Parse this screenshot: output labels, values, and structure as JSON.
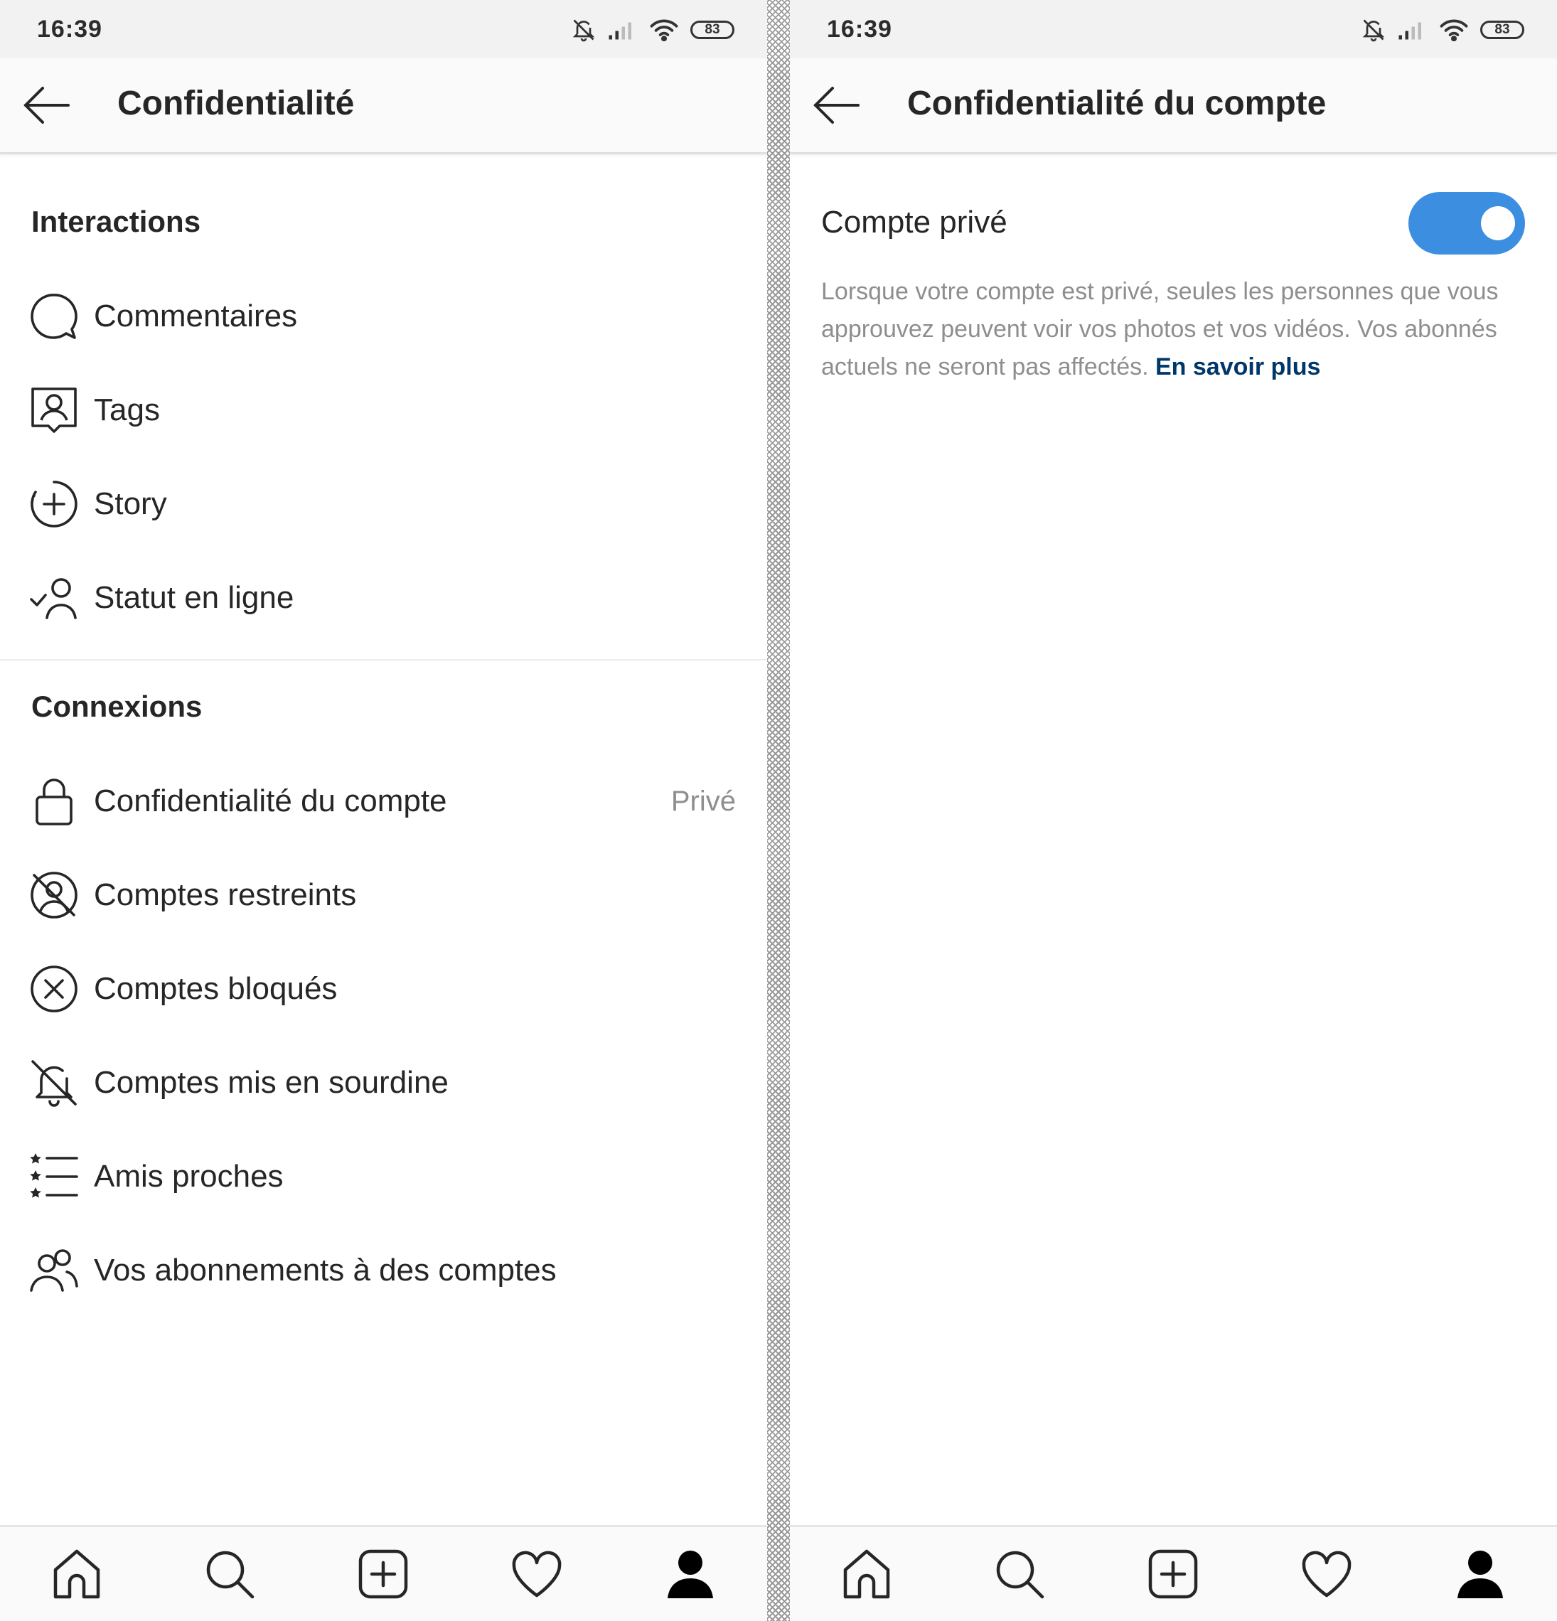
{
  "status_bar": {
    "time": "16:39",
    "battery": "83"
  },
  "left_screen": {
    "title": "Confidentialité",
    "sections": [
      {
        "header": "Interactions",
        "items": [
          {
            "icon": "comment-icon",
            "label": "Commentaires"
          },
          {
            "icon": "tag-person-icon",
            "label": "Tags"
          },
          {
            "icon": "story-add-icon",
            "label": "Story"
          },
          {
            "icon": "online-status-icon",
            "label": "Statut en ligne"
          }
        ]
      },
      {
        "header": "Connexions",
        "items": [
          {
            "icon": "lock-icon",
            "label": "Confidentialité du compte",
            "value": "Privé"
          },
          {
            "icon": "restricted-icon",
            "label": "Comptes restreints"
          },
          {
            "icon": "blocked-icon",
            "label": "Comptes bloqués"
          },
          {
            "icon": "muted-bell-icon",
            "label": "Comptes mis en sourdine"
          },
          {
            "icon": "close-friends-icon",
            "label": "Amis proches"
          },
          {
            "icon": "following-icon",
            "label": "Vos abonnements à des comptes"
          }
        ]
      }
    ]
  },
  "right_screen": {
    "title": "Confidentialité du compte",
    "private_account_label": "Compte privé",
    "private_account_enabled": true,
    "description": "Lorsque votre compte est privé, seules les personnes que vous approuvez peuvent voir vos photos et vos vidéos. Vos abonnés actuels ne seront pas affectés.",
    "learn_more_link": "En savoir plus"
  },
  "bottom_nav": [
    "home-icon",
    "search-icon",
    "new-post-icon",
    "activity-heart-icon",
    "profile-icon"
  ],
  "colors": {
    "toggle_on": "#3c8fe0",
    "link": "#00376b",
    "secondary_text": "#8e8e8e"
  }
}
